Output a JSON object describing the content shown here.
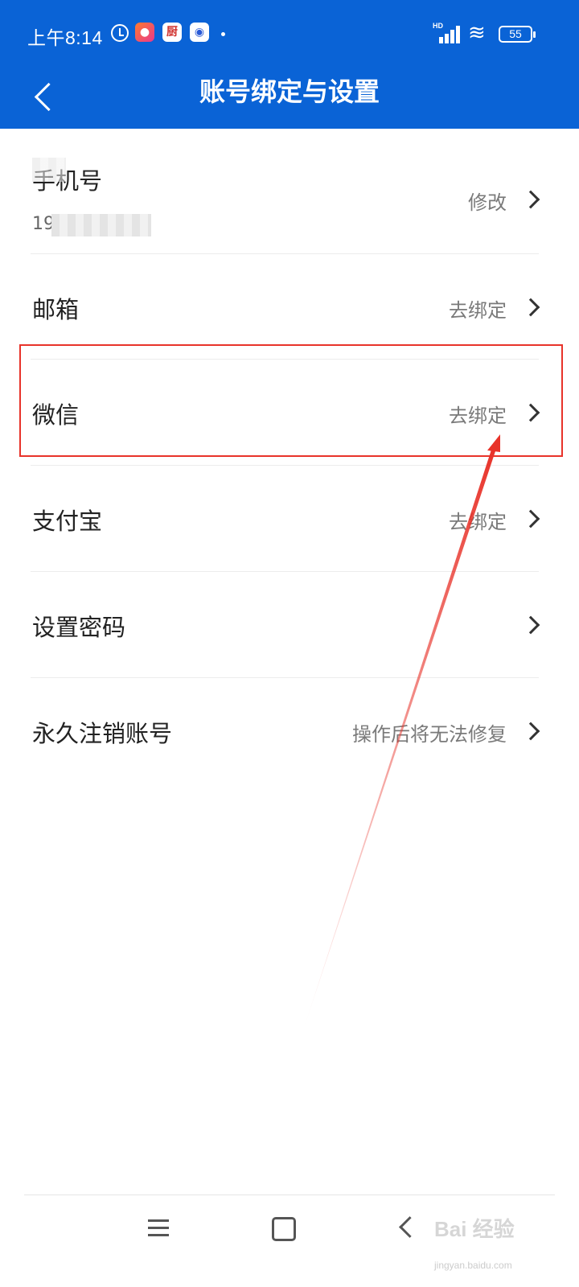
{
  "status_bar": {
    "time": "上午8:14",
    "app_icons": [
      "app-icon-1",
      "厨",
      "app-icon-3"
    ],
    "network": "HD",
    "battery": "55"
  },
  "header": {
    "title": "账号绑定与设置"
  },
  "rows": [
    {
      "label": "手机号",
      "value": "修改",
      "sub": "19"
    },
    {
      "label": "邮箱",
      "value": "去绑定"
    },
    {
      "label": "微信",
      "value": "去绑定"
    },
    {
      "label": "支付宝",
      "value": "去绑定"
    },
    {
      "label": "设置密码",
      "value": ""
    },
    {
      "label": "永久注销账号",
      "value": "操作后将无法修复"
    }
  ],
  "watermark": {
    "text": "Bai 经验",
    "sub": "jingyan.baidu.com"
  },
  "colors": {
    "header_bg": "#0a63d6",
    "annotation": "#e8332a"
  }
}
